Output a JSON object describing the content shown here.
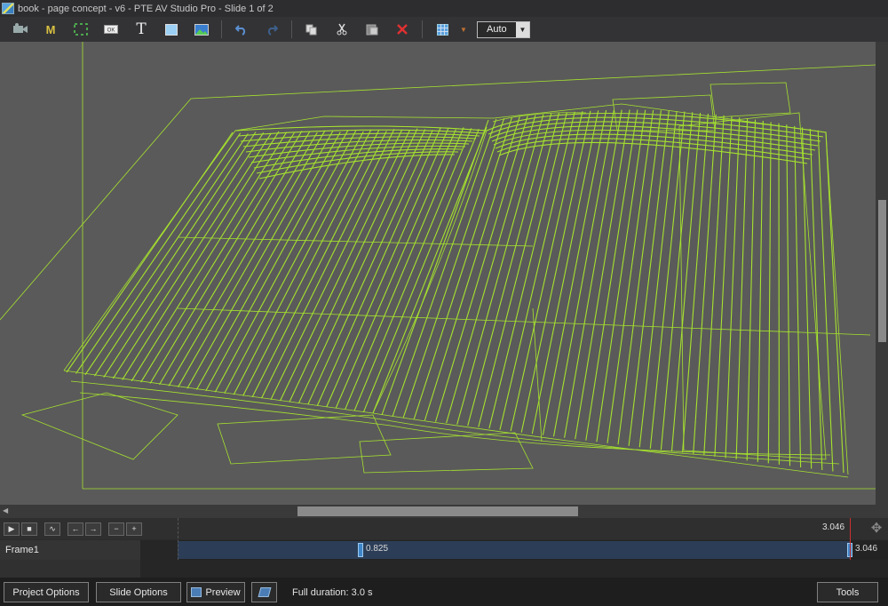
{
  "window": {
    "title": "book - page concept - v6 - PTE AV Studio Pro - Slide 1 of 2"
  },
  "toolbar": {
    "buttons": [
      {
        "name": "camera-icon",
        "glyph": "■"
      },
      {
        "name": "mask-icon",
        "glyph": "M"
      },
      {
        "name": "frame-icon",
        "glyph": "⛶"
      },
      {
        "name": "button-object-icon",
        "glyph": "▭"
      },
      {
        "name": "text-icon",
        "glyph": "T"
      },
      {
        "name": "rectangle-icon",
        "glyph": "■"
      },
      {
        "name": "image-icon",
        "glyph": "▣"
      }
    ],
    "zoom_value": "Auto"
  },
  "timeline": {
    "end_time": "3.046",
    "track_name": "Frame1",
    "keyframe_1": "0.825",
    "keyframe_2": "3.046"
  },
  "bottom": {
    "project_options": "Project Options",
    "slide_options": "Slide Options",
    "preview": "Preview",
    "full_duration": "Full duration: 3.0 s",
    "tools": "Tools"
  },
  "colors": {
    "wireframe": "#a6e22e",
    "canvas": "#5a5a5a",
    "keyframe": "#3f86c9"
  }
}
